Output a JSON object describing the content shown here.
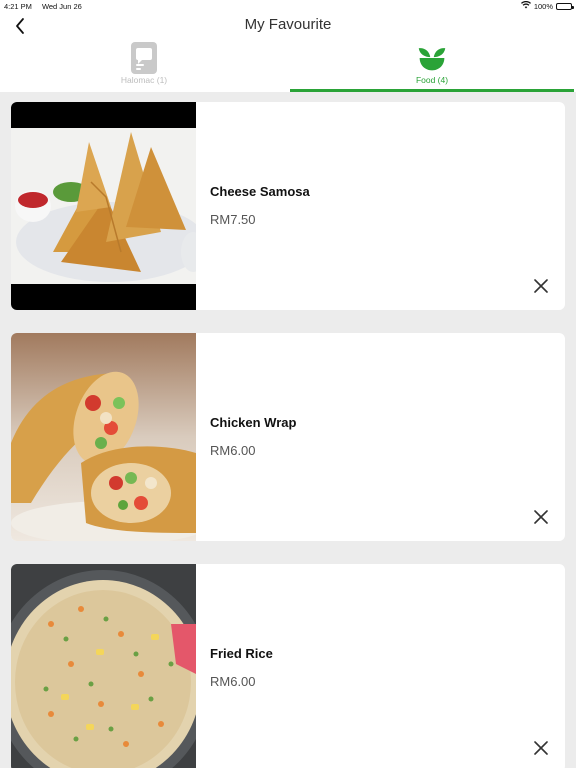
{
  "status_bar": {
    "time": "4:21 PM",
    "date": "Wed Jun 26",
    "battery": "100%"
  },
  "header": {
    "title": "My Favourite"
  },
  "tabs": [
    {
      "label": "Halomac (1)",
      "icon": "halomac-icon",
      "active": false
    },
    {
      "label": "Food (4)",
      "icon": "salad-bowl-icon",
      "active": true
    }
  ],
  "items": [
    {
      "name": "Cheese Samosa",
      "price": "RM7.50",
      "image": "cheese-samosa-photo"
    },
    {
      "name": "Chicken Wrap",
      "price": "RM6.00",
      "image": "chicken-wrap-photo"
    },
    {
      "name": "Fried Rice",
      "price": "RM6.00",
      "image": "fried-rice-photo"
    }
  ],
  "colors": {
    "accent": "#2aa337",
    "background": "#ececec"
  }
}
